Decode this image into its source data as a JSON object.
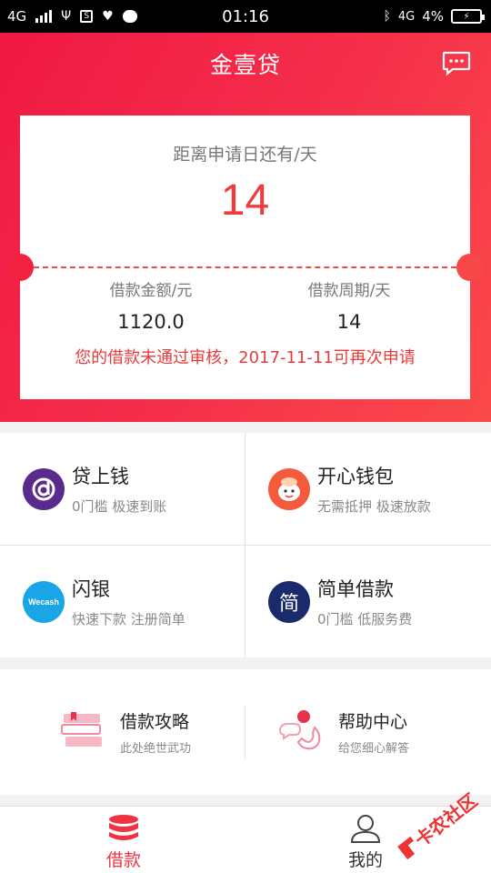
{
  "status_bar": {
    "network": "4G",
    "network_right": "4G",
    "time": "01:16",
    "battery": "4%"
  },
  "header": {
    "title": "金壹贷",
    "message_icon": "message-icon"
  },
  "card": {
    "days_label": "距离申请日还有/天",
    "days_value": "14",
    "amount_label": "借款金额/元",
    "amount_value": "1120.0",
    "period_label": "借款周期/天",
    "period_value": "14",
    "reject_message": "您的借款未通过审核，2017-11-11可再次申请"
  },
  "products": [
    {
      "name": "贷上钱",
      "desc": "0门槛 极速到账",
      "icon": "daishangqian-logo",
      "color": "#5a2a8c"
    },
    {
      "name": "开心钱包",
      "desc": "无需抵押 极速放款",
      "icon": "kaixin-logo",
      "color": "#f45a3c"
    },
    {
      "name": "闪银",
      "desc": "快速下款 注册简单",
      "icon": "wecash-logo",
      "icon_text": "Wecash",
      "color": "#1aa6e6"
    },
    {
      "name": "简单借款",
      "desc": "0门槛 低服务费",
      "icon": "jiandan-logo",
      "icon_text": "简",
      "color": "#1a2a6c"
    }
  ],
  "guides": [
    {
      "title": "借款攻略",
      "subtitle": "此处绝世武功",
      "icon": "books-icon"
    },
    {
      "title": "帮助中心",
      "subtitle": "给您细心解答",
      "icon": "phone-chat-icon"
    }
  ],
  "tabs": [
    {
      "label": "借款",
      "icon": "coins-stack-icon",
      "active": true,
      "color": "#ef3340"
    },
    {
      "label": "我的",
      "icon": "user-icon",
      "active": false,
      "color": "#333333"
    }
  ],
  "watermark": "卡农社区"
}
